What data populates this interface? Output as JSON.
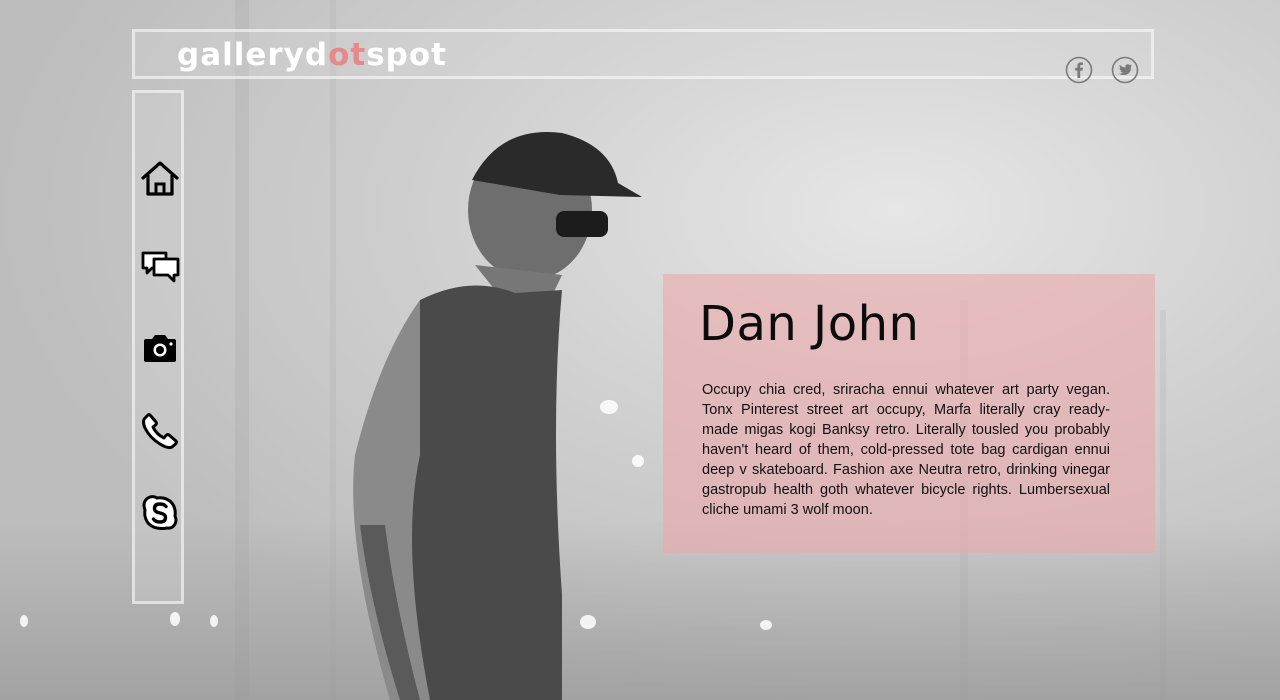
{
  "brand": {
    "logo_part1": "galleryd",
    "logo_part2": "ot",
    "logo_part3": "spot",
    "accent_color": "#e7888a"
  },
  "social": [
    {
      "icon": "facebook-icon"
    },
    {
      "icon": "twitter-icon"
    }
  ],
  "sidebar": {
    "items": [
      {
        "icon": "home-icon"
      },
      {
        "icon": "chat-icon"
      },
      {
        "icon": "camera-icon"
      },
      {
        "icon": "phone-icon"
      },
      {
        "icon": "skype-icon"
      }
    ]
  },
  "profile": {
    "name": "Dan John",
    "bio": "Occupy chia cred, sriracha ennui whatever art party vegan. Tonx Pinterest street art occupy, Marfa literally cray ready-made migas kogi Banksy retro. Literally tousled you probably haven't heard of them, cold-pressed tote bag cardigan ennui deep v skateboard. Fashion axe Neutra retro, drinking vinegar gastropub health goth whatever bicycle rights. Lumbersexual cliche umami 3 wolf moon.",
    "panel_color": "#ecaaac"
  }
}
